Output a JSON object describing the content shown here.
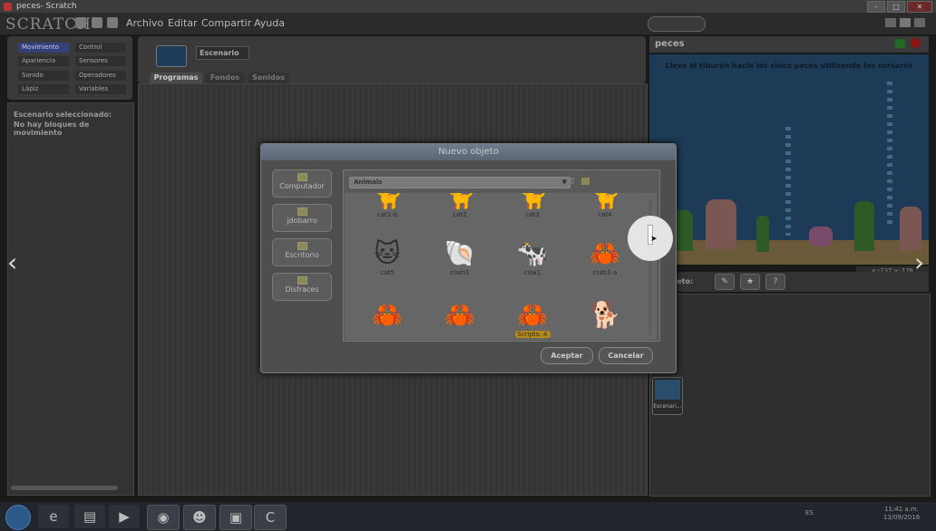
{
  "window": {
    "title": "peces- Scratch"
  },
  "app": {
    "logo": "SCRATCH",
    "menu": [
      "Archivo",
      "Editar",
      "Compartir",
      "Ayuda"
    ]
  },
  "palette": {
    "categories": [
      {
        "label": "Movimiento",
        "color": "#3b4a8c",
        "active": true
      },
      {
        "label": "Control",
        "color": "#8a6a1a"
      },
      {
        "label": "Apariencia",
        "color": "#5a3b8c"
      },
      {
        "label": "Sensores",
        "color": "#1f5a8c"
      },
      {
        "label": "Sonido",
        "color": "#7a2a8a"
      },
      {
        "label": "Operadores",
        "color": "#3a7a2a"
      },
      {
        "label": "Lápiz",
        "color": "#1f6a4a"
      },
      {
        "label": "Variables",
        "color": "#8a4a1a"
      }
    ],
    "message_line1": "Escenario seleccionado:",
    "message_line2": "No hay bloques de movimiento"
  },
  "sprite": {
    "name": "Escenario",
    "tabs": [
      "Programas",
      "Fondos",
      "Sonidos"
    ]
  },
  "stage": {
    "title": "peces",
    "instruction": "Lleva al tiburón hacia los cinco peces utilizando los cursores",
    "x_label": "x:",
    "x_value": "-237",
    "y_label": "y:",
    "y_value": "-1?8",
    "new_object_label": "o objeto:",
    "stage_sprite_label": "Escenari..."
  },
  "dialog": {
    "title": "Nuevo objeto",
    "nav": [
      "Computador",
      "jdobarro",
      "Escritorio",
      "Disfraces"
    ],
    "path": "Animals",
    "items": [
      {
        "label": "cat1-b",
        "icon": "🐈"
      },
      {
        "label": "cat2",
        "icon": "🐈"
      },
      {
        "label": "cat3",
        "icon": "🐈"
      },
      {
        "label": "cat4",
        "icon": "🐈"
      },
      {
        "label": "cat5",
        "icon": "🐱"
      },
      {
        "label": "clam1",
        "icon": "🐚"
      },
      {
        "label": "cow1",
        "icon": "🐄"
      },
      {
        "label": "crab1-a",
        "icon": "🦀"
      },
      {
        "label": "",
        "icon": "🦀"
      },
      {
        "label": "",
        "icon": "🦀"
      },
      {
        "label": "Scripts: 4",
        "icon": "🦀"
      },
      {
        "label": "",
        "icon": "🐕"
      }
    ],
    "ok_label": "Aceptar",
    "cancel_label": "Cancelar"
  },
  "taskbar": {
    "apps": [
      "ie",
      "explorer",
      "media",
      "chrome",
      "scratch",
      "powerpoint",
      "camtasia"
    ],
    "lang": "ES",
    "time": "11:41 a.m.",
    "date": "13/09/2016"
  },
  "nav_arrows": {
    "prev": "‹",
    "next": "›"
  }
}
